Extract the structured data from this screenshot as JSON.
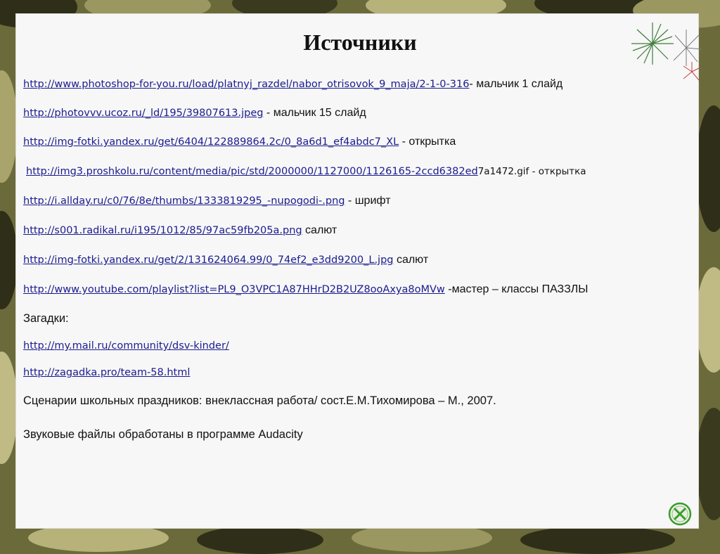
{
  "title": "Источники",
  "lines": [
    {
      "url": "http://www.photoshop-for-you.ru/load/platnyj_razdel/nabor_otrisovok_9_maja/2-1-0-316",
      "note": "- мальчик 1 слайд"
    },
    {
      "url": "http://photovvv.ucoz.ru/_ld/195/39807613.jpeg",
      "note": " - мальчик 15 слайд"
    },
    {
      "url": "http://img-fotki.yandex.ru/get/6404/122889864.2c/0_8a6d1_ef4abdc7_XL",
      "note": "  - открытка"
    },
    {
      "url": "http://img3.proshkolu.ru/content/media/pic/std/2000000/1127000/1126165-2ccd6382ed",
      "note": "7a1472.gif - открытка"
    },
    {
      "url": "http://i.allday.ru/c0/76/8e/thumbs/1333819295_-nupogodi-.png",
      "note": " - шрифт"
    },
    {
      "url": "http://s001.radikal.ru/i195/1012/85/97ac59fb205a.png",
      "note": " салют"
    },
    {
      "url": "http://img-fotki.yandex.ru/get/2/131624064.99/0_74ef2_e3dd9200_L.jpg",
      "note": " салют"
    },
    {
      "url": "http://www.youtube.com/playlist?list=PL9_O3VPC1A87HHrD2B2UZ8ooAxya8oMVw",
      "note": " -мастер – классы ПАЗЗЛЫ"
    }
  ],
  "riddles_label": "Загадки:",
  "riddle_links": [
    "http://my.mail.ru/community/dsv-kinder/",
    "http://zagadka.pro/team-58.html"
  ],
  "book_ref": "Сценарии школьных праздников: внеклассная работа/ сост.Е.М.Тихомирова –  М., 2007.",
  "audio_note": "Звуковые файлы обработаны в программе Audacity",
  "icons": {
    "decoration": "fireworks-icon",
    "nav": "close-circle-icon"
  },
  "colors": {
    "link": "#1b1b8f",
    "frame": "#6b6a3a",
    "nav_green": "#3c9a2c"
  }
}
